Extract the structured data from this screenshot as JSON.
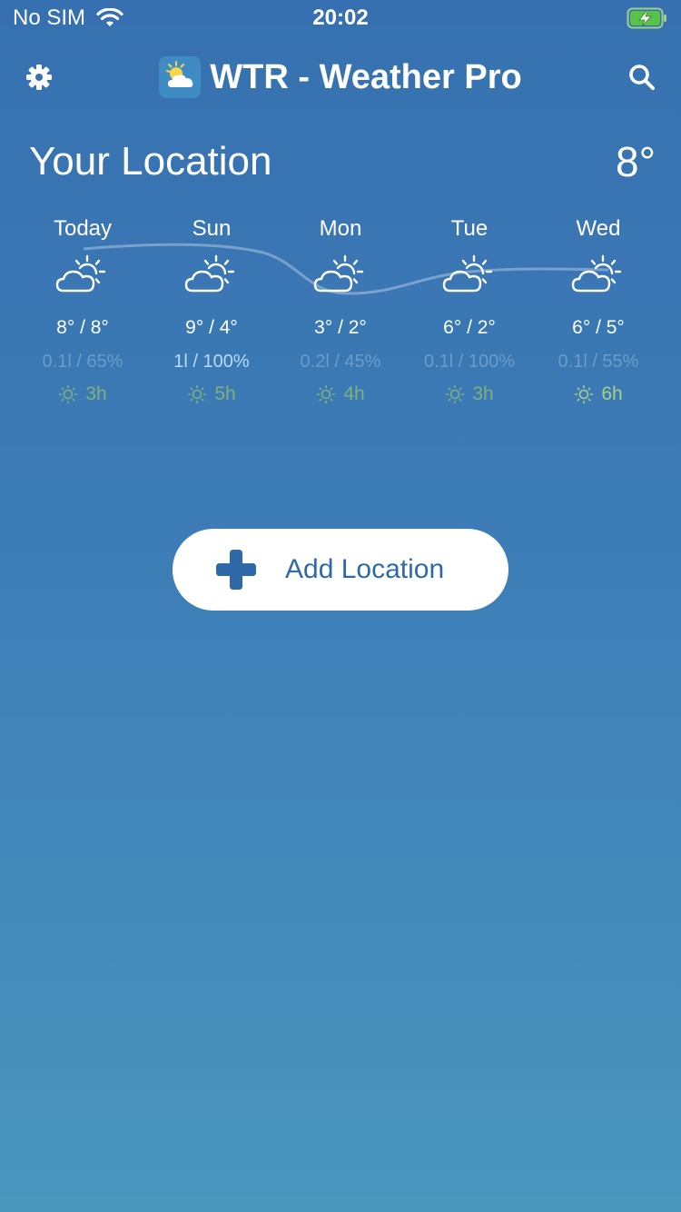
{
  "status_bar": {
    "carrier": "No SIM",
    "time": "20:02",
    "wifi_icon": "wifi-icon",
    "battery_icon": "battery-charging-icon"
  },
  "header": {
    "title": "WTR - Weather Pro",
    "settings_icon": "gear-icon",
    "search_icon": "search-icon",
    "logo_icon": "sun-cloud-logo"
  },
  "location": {
    "name": "Your Location",
    "current_temp": "8°"
  },
  "forecast": {
    "days": [
      {
        "name": "Today",
        "temps": "8° / 8°",
        "precip": "0.1l / 65%",
        "sun": "3h",
        "icon": "partly-cloudy-icon"
      },
      {
        "name": "Sun",
        "temps": "9° / 4°",
        "precip": "1l / 100%",
        "sun": "5h",
        "icon": "partly-cloudy-icon"
      },
      {
        "name": "Mon",
        "temps": "3° / 2°",
        "precip": "0.2l / 45%",
        "sun": "4h",
        "icon": "partly-cloudy-icon"
      },
      {
        "name": "Tue",
        "temps": "6° / 2°",
        "precip": "0.1l / 100%",
        "sun": "3h",
        "icon": "partly-cloudy-icon"
      },
      {
        "name": "Wed",
        "temps": "6° / 5°",
        "precip": "0.1l / 55%",
        "sun": "6h",
        "icon": "partly-cloudy-icon"
      }
    ]
  },
  "actions": {
    "add_location_label": "Add Location",
    "add_icon": "plus-icon"
  },
  "colors": {
    "background_top": "#3670b0",
    "background_bottom": "#4a96bd",
    "accent": "#2f6aa8",
    "precip_highlight": "#b8dcff",
    "sun_hours": "#7fb07e"
  }
}
